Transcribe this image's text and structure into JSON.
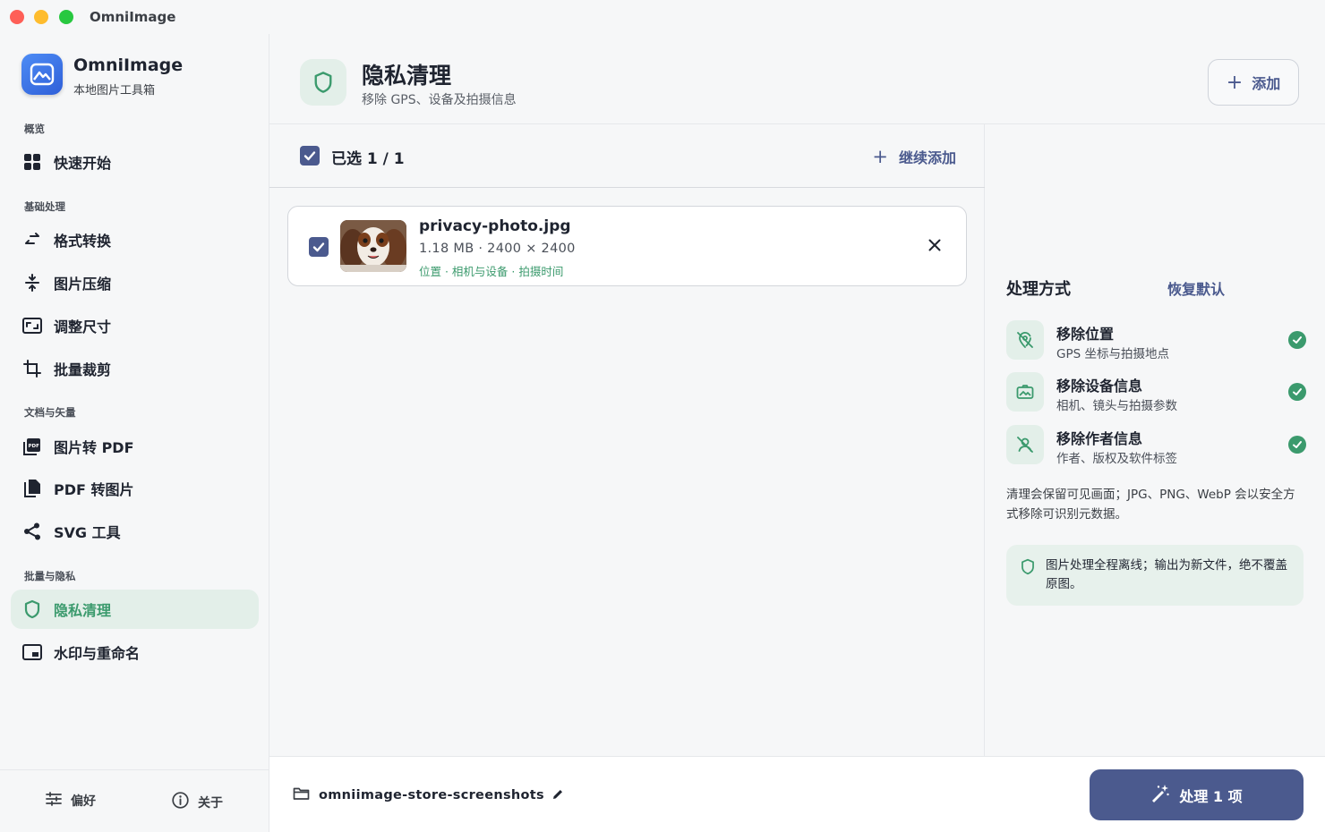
{
  "window": {
    "title": "OmniImage"
  },
  "app": {
    "name": "OmniImage",
    "subtitle": "本地图片工具箱"
  },
  "sidebar": {
    "sections": [
      {
        "label": "概览",
        "items": [
          {
            "label": "快速开始",
            "icon": "grid-icon"
          }
        ]
      },
      {
        "label": "基础处理",
        "items": [
          {
            "label": "格式转换",
            "icon": "swap-icon"
          },
          {
            "label": "图片压缩",
            "icon": "compress-icon"
          },
          {
            "label": "调整尺寸",
            "icon": "resize-icon"
          },
          {
            "label": "批量裁剪",
            "icon": "crop-icon"
          }
        ]
      },
      {
        "label": "文档与矢量",
        "items": [
          {
            "label": "图片转 PDF",
            "icon": "pdf-icon"
          },
          {
            "label": "PDF 转图片",
            "icon": "copy-icon"
          },
          {
            "label": "SVG 工具",
            "icon": "share-icon"
          }
        ]
      },
      {
        "label": "批量与隐私",
        "items": [
          {
            "label": "隐私清理",
            "icon": "shield-icon",
            "active": true
          },
          {
            "label": "水印与重命名",
            "icon": "picture-in-picture-icon"
          }
        ]
      }
    ],
    "footer": {
      "preferences": "偏好",
      "about": "关于"
    }
  },
  "header": {
    "title": "隐私清理",
    "subtitle": "移除 GPS、设备及拍摄信息",
    "add_label": "添加"
  },
  "list": {
    "selected_label": "已选 1 / 1",
    "continue_add_label": "继续添加",
    "files": [
      {
        "name": "privacy-photo.jpg",
        "meta": "1.18 MB · 2400 × 2400",
        "tags": "位置 · 相机与设备 · 拍摄时间",
        "checked": true
      }
    ]
  },
  "panel": {
    "heading": "处理方式",
    "restore_label": "恢复默认",
    "options": [
      {
        "title": "移除位置",
        "desc": "GPS 坐标与拍摄地点",
        "icon": "location-off-icon",
        "enabled": true
      },
      {
        "title": "移除设备信息",
        "desc": "相机、镜头与拍摄参数",
        "icon": "camera-icon",
        "enabled": true
      },
      {
        "title": "移除作者信息",
        "desc": "作者、版权及软件标签",
        "icon": "person-off-icon",
        "enabled": true
      }
    ],
    "note": "清理会保留可见画面；JPG、PNG、WebP 会以安全方式移除可识别元数据。",
    "offline_note": "图片处理全程离线；输出为新文件，绝不覆盖原图。"
  },
  "bottom": {
    "folder_name": "omniimage-store-screenshots",
    "process_label": "处理 1 项"
  },
  "colors": {
    "accent": "#4b5a8e",
    "success": "#3b9a6d",
    "sidebar_bg": "#f6f7f8",
    "active_bg": "#e3efe9"
  }
}
